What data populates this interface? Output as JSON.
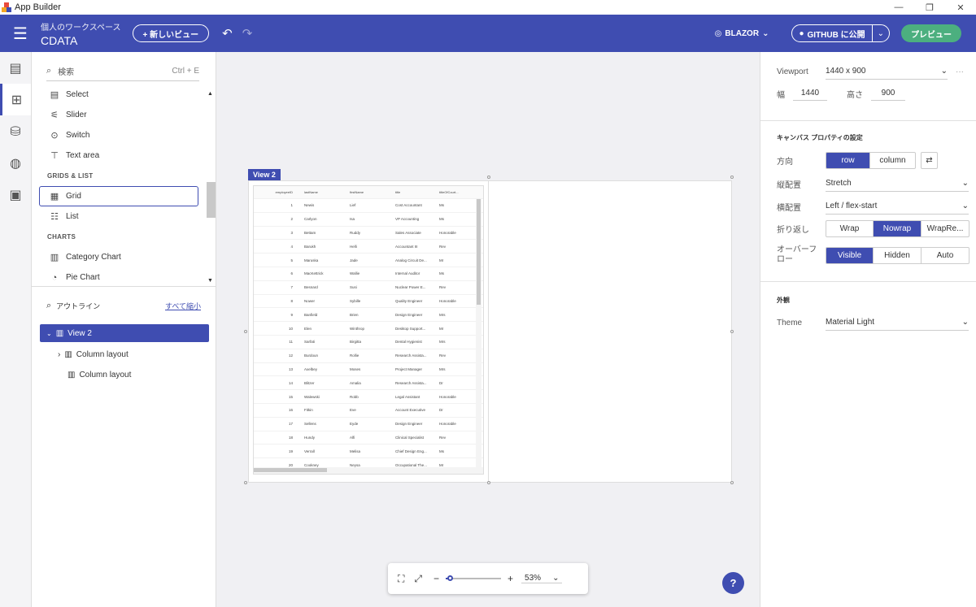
{
  "window": {
    "title": "App Builder",
    "controls": [
      "—",
      "❐",
      "✕"
    ]
  },
  "header": {
    "workspace_label": "個人のワークスペース",
    "workspace_name": "CDATA",
    "new_view": "+ 新しいビュー",
    "framework": "BLAZOR",
    "github": "GITHUB に公開",
    "preview": "プレビュー"
  },
  "components": {
    "search_placeholder": "検索",
    "search_shortcut": "Ctrl + E",
    "items_top": [
      {
        "label": "Select",
        "icon": "select-icon"
      },
      {
        "label": "Slider",
        "icon": "slider-icon"
      },
      {
        "label": "Switch",
        "icon": "switch-icon"
      },
      {
        "label": "Text area",
        "icon": "textarea-icon"
      }
    ],
    "section_grids": "GRIDS & LIST",
    "items_grids": [
      {
        "label": "Grid",
        "icon": "grid-icon"
      },
      {
        "label": "List",
        "icon": "list-icon"
      }
    ],
    "section_charts": "CHARTS",
    "items_charts": [
      {
        "label": "Category Chart",
        "icon": "bar-chart-icon"
      },
      {
        "label": "Pie Chart",
        "icon": "pie-chart-icon"
      }
    ]
  },
  "outline": {
    "title": "アウトライン",
    "collapse_all": "すべて縮小",
    "nodes": [
      {
        "label": "View 2"
      },
      {
        "label": "Column layout"
      },
      {
        "label": "Column layout"
      }
    ]
  },
  "canvas": {
    "view_label": "View 2",
    "grid": {
      "columns": [
        "employeeID",
        "lastName",
        "firstName",
        "title",
        "titleOfCourt..."
      ],
      "rows": [
        [
          "1",
          "Newis",
          "Lief",
          "Cost Accountant",
          "Ms"
        ],
        [
          "2",
          "Carlyon",
          "Isa",
          "VP Accounting",
          "Ms"
        ],
        [
          "3",
          "Bettam",
          "Ruddy",
          "Sales Associate",
          "Honorable"
        ],
        [
          "4",
          "Barukh",
          "Helli",
          "Accountant III",
          "Rev"
        ],
        [
          "5",
          "Maruska",
          "Jade",
          "Analog Circuit De...",
          "Mr"
        ],
        [
          "6",
          "MacKettrick",
          "Wallie",
          "Internal Auditor",
          "Ms"
        ],
        [
          "7",
          "Besnard",
          "Susi",
          "Nuclear Power E...",
          "Rev"
        ],
        [
          "8",
          "Nower",
          "Sybille",
          "Quality Engineer",
          "Honorable"
        ],
        [
          "9",
          "Banfield",
          "Brien",
          "Design Engineer",
          "Mrs"
        ],
        [
          "10",
          "Elen",
          "Winthrop",
          "Desktop Support...",
          "Mr"
        ],
        [
          "11",
          "Sarfati",
          "Birgitta",
          "Dental Hygienist",
          "Mrs"
        ],
        [
          "12",
          "Burdoun",
          "Rollie",
          "Research Assista...",
          "Rev"
        ],
        [
          "13",
          "Axelbey",
          "Moses",
          "Project Manager",
          "Mrs"
        ],
        [
          "14",
          "Blitzer",
          "Amalia",
          "Research Assista...",
          "Dr"
        ],
        [
          "15",
          "Walewski",
          "Robb",
          "Legal Assistant",
          "Honorable"
        ],
        [
          "16",
          "Fitkin",
          "Eve",
          "Account Executive",
          "Dr"
        ],
        [
          "17",
          "Sellens",
          "Eyde",
          "Design Engineer",
          "Honorable"
        ],
        [
          "18",
          "Hundy",
          "Alfi",
          "Clinical Specialist",
          "Rev"
        ],
        [
          "19",
          "Verrall",
          "Melisa",
          "Chief Design Eng...",
          "Ms"
        ],
        [
          "20",
          "Cookney",
          "Neysa",
          "Occupational The...",
          "Mr"
        ]
      ]
    },
    "zoom": "53%",
    "zoom_level": 0.08,
    "help": "?"
  },
  "properties": {
    "viewport_label": "Viewport",
    "viewport_value": "1440 x 900",
    "width_label": "幅",
    "width_value": "1440",
    "height_label": "高さ",
    "height_value": "900",
    "canvas_section": "キャンバス プロパティの設定",
    "direction_label": "方向",
    "direction_options": [
      "row",
      "column"
    ],
    "direction_selected": "row",
    "valign_label": "縦配置",
    "valign_value": "Stretch",
    "halign_label": "横配置",
    "halign_value": "Left / flex-start",
    "wrap_label": "折り返し",
    "wrap_options": [
      "Wrap",
      "Nowrap",
      "WrapRe..."
    ],
    "wrap_selected": "Nowrap",
    "overflow_label": "オーバーフロー",
    "overflow_options": [
      "Visible",
      "Hidden",
      "Auto"
    ],
    "overflow_selected": "Visible",
    "appearance_section": "外観",
    "theme_label": "Theme",
    "theme_value": "Material Light"
  },
  "colors": {
    "primary": "#3f4db1",
    "preview": "#4caf7f"
  }
}
